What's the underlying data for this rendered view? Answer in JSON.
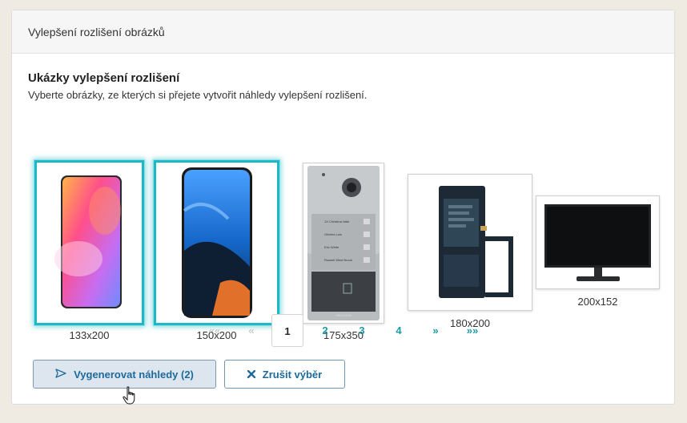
{
  "panel": {
    "title": "Vylepšení rozlišení obrázků"
  },
  "section": {
    "title": "Ukázky vylepšení rozlišení",
    "description": "Vyberte obrázky, ze kterých si přejete vytvořit náhledy vylepšení rozlišení."
  },
  "images": [
    {
      "label": "133x200",
      "selected": true,
      "icon": "smartphone-pink-image"
    },
    {
      "label": "150x200",
      "selected": true,
      "icon": "smartphone-blue-image"
    },
    {
      "label": "175x350",
      "selected": false,
      "icon": "door-intercom-image"
    },
    {
      "label": "180x200",
      "selected": false,
      "icon": "battery-image"
    },
    {
      "label": "200x152",
      "selected": false,
      "icon": "monitor-image"
    }
  ],
  "intercom": {
    "buttons": [
      "1X Christina Valle",
      "Oliveira Luis",
      "Eric White",
      "Russell West Brook"
    ],
    "brand": "HIKVISION"
  },
  "pagination": {
    "first": "««",
    "prev": "«",
    "pages": [
      "1",
      "2",
      "3",
      "4"
    ],
    "current": "1",
    "next": "»",
    "last": "»»"
  },
  "actions": {
    "generate_label": "Vygenerovat náhledy (2)",
    "cancel_label": "Zrušit výběr"
  },
  "colors": {
    "accent": "#1bb9c6",
    "link": "#1a9aa6",
    "button_text": "#1e6a9b",
    "background": "#efebe3"
  }
}
